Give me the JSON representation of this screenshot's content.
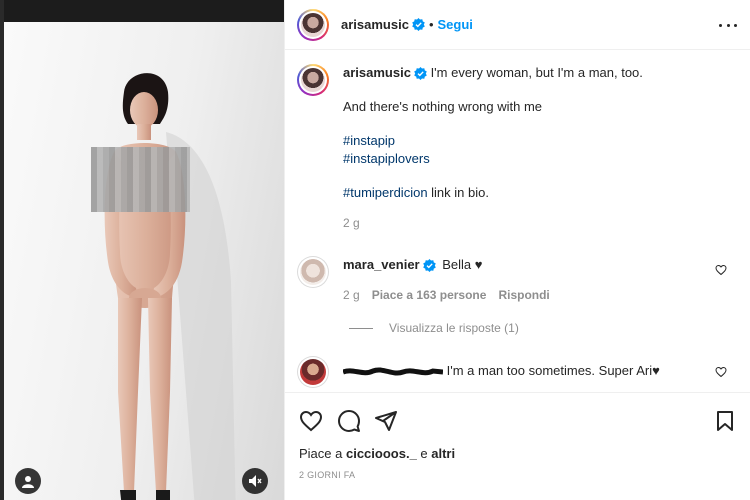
{
  "post": {
    "username": "arisamusic",
    "follow_label": "Segui",
    "dot": "•"
  },
  "caption": {
    "username": "arisamusic",
    "line1": "I'm every woman, but I'm a man, too.",
    "line2": "And there's nothing wrong with me",
    "hashtags": [
      "#instapip",
      "#instapiplovers"
    ],
    "line3_tag": "#tumiperdicion",
    "line3_rest": " link in bio.",
    "time": "2 g"
  },
  "comments": [
    {
      "username": "mara_venier",
      "text": "Bella ♥",
      "time": "2 g",
      "likes": "Piace a 163 persone",
      "reply_label": "Rispondi"
    },
    {
      "text": "I'm a man too sometimes. Super Ari♥"
    }
  ],
  "replies_label": "Visualizza le risposte (1)",
  "likes": {
    "prefix": "Piace a ",
    "user": "cicciooos._",
    "middle": " e ",
    "rest": "altri"
  },
  "timestamp": "2 GIORNI FA",
  "icons": {
    "like": "heart-icon",
    "comment": "comment-icon",
    "share": "paper-plane-icon",
    "save": "bookmark-icon",
    "more": "more-icon",
    "verified": "verified-icon"
  },
  "colors": {
    "link": "#0095f6",
    "hashtag": "#00376b",
    "muted": "#8e8e8e",
    "verified": "#0095f6"
  }
}
